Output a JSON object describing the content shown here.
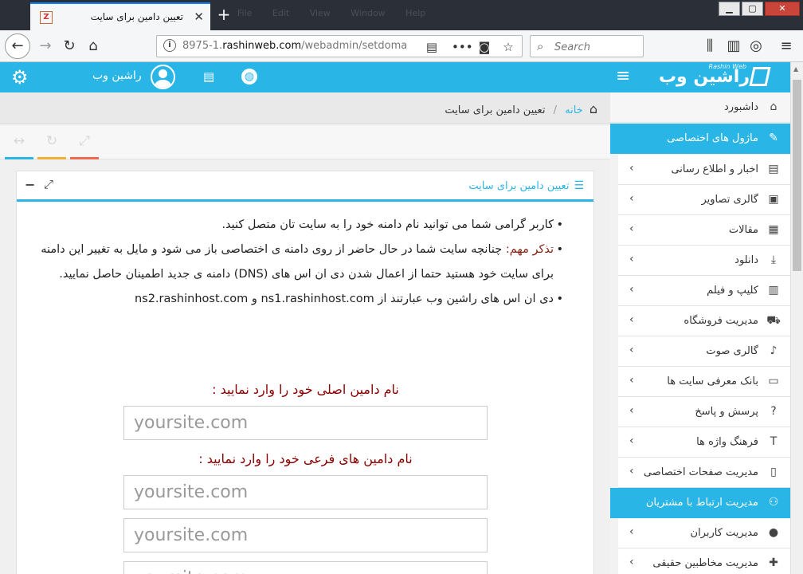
{
  "browser": {
    "tab_title": "تعیین دامین برای سایت",
    "favicon": "Z",
    "close_glyph": "✕",
    "newtab_glyph": "+",
    "ghost_menu": "File Edit View Window Help",
    "url_host": "8975-1.",
    "url_domain": "rashinweb.com",
    "url_path": "/webadmin/setdoma",
    "search_placeholder": "Search",
    "icons": [
      "back-icon",
      "forward-icon",
      "reload-icon",
      "home-icon",
      "info-icon",
      "reader-icon",
      "more-icon",
      "pocket-icon",
      "bookmark-star-icon",
      "library-icon",
      "sidebar-icon",
      "globe-icon",
      "hamburger-icon"
    ]
  },
  "header": {
    "username": "راشین وب",
    "logo_text": "راشین وب",
    "logo_en": "Rashin Web",
    "accent": "#29b6e6"
  },
  "breadcrumb": {
    "home": "خانه",
    "current": "تعیین دامین برای سایت"
  },
  "panel": {
    "title": "تعیین دامین برای سایت",
    "notes": {
      "n1": "کاربر گرامی شما می توانید نام دامنه خود را به سایت تان متصل کنید.",
      "n2_label": "تذکر مهم:",
      "n2_text": " چنانچه سایت شما در حال حاضر از روی دامنه ی اختصاصی باز می شود و مایل به تغییر این دامنه برای سایت خود هستید حتما از اعمال شدن دی ان اس های (DNS) دامنه ی جدید اطمینان حاصل نمایید.",
      "n3_text": "دی ان اس های راشین وب عبارتند از",
      "ns1": "ns1.rashinhost.com",
      "ns_and": "و",
      "ns2": "ns2.rashinhost.com"
    },
    "main_label": "نام دامین اصلی خود را وارد نمایید :",
    "sub_label": "نام دامین های فرعی خود را وارد نمایید :",
    "placeholder": "yoursite.com"
  },
  "sidebar": {
    "items": [
      {
        "label": "داشبورد",
        "icon": "⌂"
      },
      {
        "label": "ماژول های اختصاصی",
        "icon": "✎"
      },
      {
        "label": "اخبار و اطلاع رسانی",
        "icon": "▤"
      },
      {
        "label": "گالری تصاویر",
        "icon": "▣"
      },
      {
        "label": "مقالات",
        "icon": "▦"
      },
      {
        "label": "دانلود",
        "icon": "⤓"
      },
      {
        "label": "کلیپ و فیلم",
        "icon": "▥"
      },
      {
        "label": "مدیریت فروشگاه",
        "icon": "⛟"
      },
      {
        "label": "گالری صوت",
        "icon": "♪"
      },
      {
        "label": "بانک معرفی سایت ها",
        "icon": "▭"
      },
      {
        "label": "پرسش و پاسخ",
        "icon": "?"
      },
      {
        "label": "فرهنگ واژه ها",
        "icon": "T"
      },
      {
        "label": "مدیریت صفحات اختصاصی",
        "icon": "▯"
      },
      {
        "label": "مدیریت ارتباط با مشتریان",
        "icon": "⚇"
      },
      {
        "label": "مدیریت کاربران",
        "icon": "●"
      },
      {
        "label": "مدیریت مخاطبین حقیقی",
        "icon": "✚"
      }
    ]
  }
}
